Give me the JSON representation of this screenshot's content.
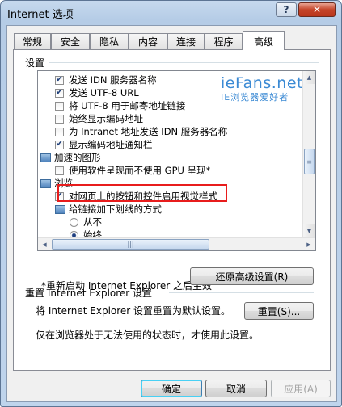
{
  "window": {
    "title": "Internet 选项",
    "help_glyph": "?",
    "close_glyph": "✕"
  },
  "tabs": [
    {
      "label": "常规"
    },
    {
      "label": "安全"
    },
    {
      "label": "隐私"
    },
    {
      "label": "内容"
    },
    {
      "label": "连接"
    },
    {
      "label": "程序"
    },
    {
      "label": "高级",
      "active": true
    }
  ],
  "settings": {
    "label": "设置",
    "items": [
      {
        "type": "checkbox",
        "checked": true,
        "label": "发送 IDN 服务器名称"
      },
      {
        "type": "checkbox",
        "checked": true,
        "label": "发送 UTF-8 URL"
      },
      {
        "type": "checkbox",
        "checked": false,
        "label": "将 UTF-8 用于邮寄地址链接"
      },
      {
        "type": "checkbox",
        "checked": false,
        "label": "始终显示编码地址"
      },
      {
        "type": "checkbox",
        "checked": false,
        "label": "为 Intranet 地址发送 IDN 服务器名称"
      },
      {
        "type": "checkbox",
        "checked": true,
        "label": "显示编码地址通知栏"
      },
      {
        "type": "category",
        "label": "加速的图形",
        "icon": "graphics-folder-icon"
      },
      {
        "type": "checkbox",
        "checked": false,
        "label": "使用软件呈现而不使用 GPU 呈现*"
      },
      {
        "type": "category",
        "label": "浏览",
        "icon": "browsing-folder-icon"
      },
      {
        "type": "checkbox",
        "checked": true,
        "label": "对网页上的按钮和控件启用视觉样式"
      },
      {
        "type": "category",
        "label": "给链接加下划线的方式",
        "icon": "underline-folder-icon"
      },
      {
        "type": "radio",
        "checked": false,
        "label": "从不"
      },
      {
        "type": "radio",
        "checked": true,
        "label": "始终"
      }
    ],
    "watermark_main": "ieFans.net",
    "watermark_sub": "IE浏览器爱好者"
  },
  "restart_note": "*重新启动 Internet Explorer 之后生效",
  "restore_button": "还原高级设置(R)",
  "reset_section": {
    "title": "重置 Internet Explorer 设置",
    "description": "将 Internet Explorer 设置重置为默认设置。",
    "button": "重置(S)...",
    "hint": "仅在浏览器处于无法使用的状态时，才使用此设置。"
  },
  "footer": {
    "ok": "确定",
    "cancel": "取消",
    "apply": "应用(A)"
  },
  "colors": {
    "highlight_border": "#e81c1c",
    "watermark": "#3b8ad4"
  }
}
